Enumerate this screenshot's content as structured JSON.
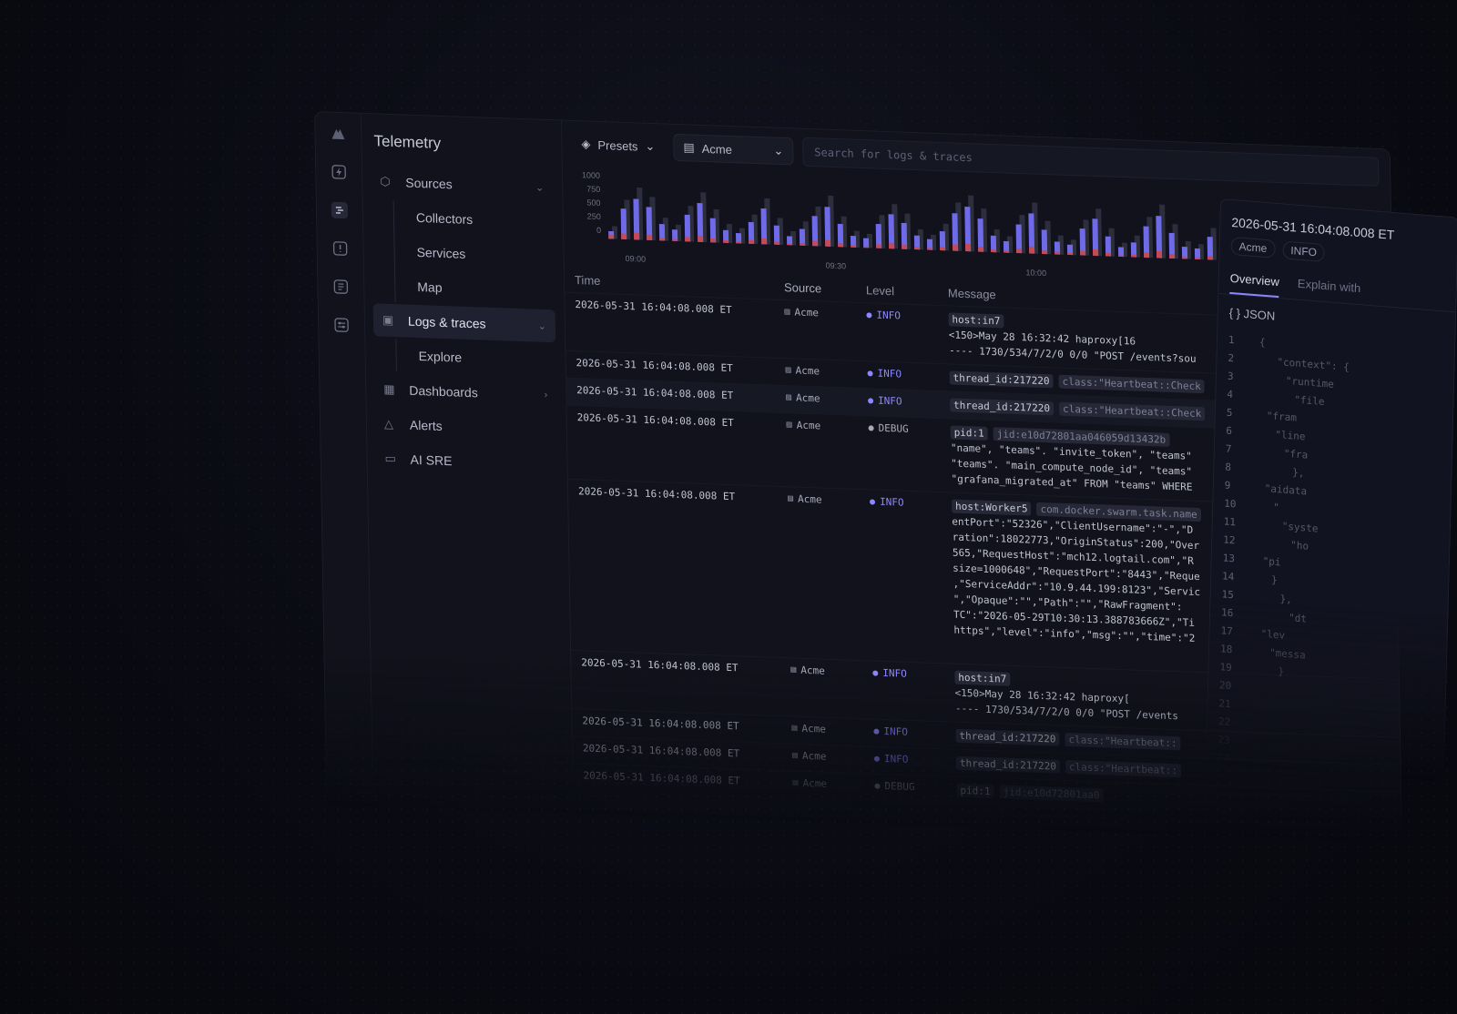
{
  "app": {
    "title": "Telemetry"
  },
  "sidebar": {
    "sources": "Sources",
    "sources_sub": [
      "Collectors",
      "Services",
      "Map"
    ],
    "logs": "Logs & traces",
    "logs_sub": [
      "Explore"
    ],
    "dashboards": "Dashboards",
    "alerts": "Alerts",
    "ai": "AI SRE"
  },
  "topbar": {
    "presets": "Presets",
    "source": "Acme",
    "search_placeholder": "Search for logs & traces"
  },
  "chart_data": {
    "type": "bar",
    "y_ticks": [
      "1000",
      "750",
      "500",
      "250",
      "0"
    ],
    "x_ticks": [
      "09:00",
      "09:30",
      "10:00"
    ],
    "ylim": [
      0,
      1000
    ],
    "series": [
      {
        "values": [
          120,
          480,
          640,
          520,
          260,
          180,
          420,
          610,
          380,
          200,
          160,
          340,
          560,
          300,
          140,
          260,
          470,
          620,
          360,
          180,
          150,
          380,
          540,
          410,
          220,
          170,
          300,
          590,
          700,
          520,
          260,
          180,
          450,
          630,
          380,
          200,
          160,
          420,
          580,
          310,
          150,
          230,
          490,
          660,
          400,
          190,
          170,
          360,
          560,
          330,
          160,
          280,
          520,
          610,
          390,
          200,
          160,
          420,
          500,
          250
        ]
      },
      {
        "values": [
          60,
          90,
          110,
          80,
          40,
          30,
          70,
          100,
          60,
          40,
          30,
          60,
          90,
          50,
          20,
          40,
          80,
          100,
          60,
          30,
          20,
          60,
          90,
          70,
          40,
          30,
          50,
          100,
          120,
          80,
          40,
          30,
          70,
          110,
          60,
          40,
          30,
          70,
          100,
          50,
          20,
          40,
          80,
          110,
          70,
          30,
          30,
          60,
          90,
          50,
          30,
          50,
          90,
          100,
          60,
          40,
          30,
          70,
          80,
          40
        ]
      },
      {
        "values": [
          200,
          620,
          820,
          680,
          360,
          260,
          560,
          780,
          520,
          300,
          240,
          460,
          720,
          420,
          220,
          380,
          620,
          800,
          480,
          260,
          220,
          520,
          700,
          560,
          320,
          240,
          420,
          760,
          880,
          680,
          360,
          260,
          600,
          800,
          520,
          300,
          240,
          560,
          740,
          440,
          220,
          340,
          640,
          840,
          540,
          280,
          240,
          500,
          720,
          460,
          240,
          400,
          680,
          780,
          520,
          300,
          240,
          560,
          660,
          360
        ]
      }
    ],
    "colors": {
      "info": "#6f6ae8",
      "error": "#c24b55",
      "total": "#2c2e3d"
    }
  },
  "table": {
    "headers": [
      "Time",
      "Source",
      "Level",
      "Message"
    ],
    "rows": [
      {
        "time": "2026-05-31 16:04:08.008 ET",
        "source": "Acme",
        "level": "INFO",
        "tags": [
          "host:in7"
        ],
        "lines": [
          "<150>May 28 16:32:42 haproxy[16",
          "---- 1730/534/7/2/0 0/0 \"POST /events?sou"
        ]
      },
      {
        "time": "2026-05-31 16:04:08.008 ET",
        "source": "Acme",
        "level": "INFO",
        "tags": [
          "thread_id:217220",
          "class:\"Heartbeat::Check"
        ],
        "lines": []
      },
      {
        "time": "2026-05-31 16:04:08.008 ET",
        "source": "Acme",
        "level": "INFO",
        "tags": [
          "thread_id:217220",
          "class:\"Heartbeat::Check"
        ],
        "lines": []
      },
      {
        "time": "2026-05-31 16:04:08.008 ET",
        "source": "Acme",
        "level": "DEBUG",
        "tags": [
          "pid:1",
          "jid:e10d72801aa046059d13432b"
        ],
        "lines": [
          "\"name\", \"teams\". \"invite_token\", \"teams\"",
          "\"teams\". \"main_compute_node_id\", \"teams\"",
          "\"grafana_migrated_at\" FROM \"teams\" WHERE"
        ]
      },
      {
        "time": "2026-05-31 16:04:08.008 ET",
        "source": "Acme",
        "level": "INFO",
        "tags": [
          "host:Worker5",
          "com.docker.swarm.task.name"
        ],
        "lines": [
          "entPort\":\"52326\",\"ClientUsername\":\"-\",\"D",
          "ration\":18022773,\"OriginStatus\":200,\"Over",
          "565,\"RequestHost\":\"mch12.logtail.com\",\"R",
          "size=1000648\",\"RequestPort\":\"8443\",\"Reque",
          ",\"ServiceAddr\":\"10.9.44.199:8123\",\"Servic",
          "\",\"Opaque\":\"\",\"Path\":\"\",\"RawFragment\":",
          "TC\":\"2026-05-29T10:30:13.388783666Z\",\"Ti",
          "https\",\"level\":\"info\",\"msg\":\"\",\"time\":\"2"
        ]
      },
      {
        "time": "2026-05-31 16:04:08.008 ET",
        "source": "Acme",
        "level": "INFO",
        "tags": [
          "host:in7"
        ],
        "lines": [
          "<150>May 28 16:32:42 haproxy[",
          "---- 1730/534/7/2/0 0/0 \"POST /events"
        ]
      },
      {
        "time": "2026-05-31 16:04:08.008 ET",
        "source": "Acme",
        "level": "INFO",
        "tags": [
          "thread_id:217220",
          "class:\"Heartbeat::"
        ],
        "lines": []
      },
      {
        "time": "2026-05-31 16:04:08.008 ET",
        "source": "Acme",
        "level": "INFO",
        "tags": [
          "thread_id:217220",
          "class:\"Heartbeat::"
        ],
        "lines": []
      },
      {
        "time": "2026-05-31 16:04:08.008 ET",
        "source": "Acme",
        "level": "DEBUG",
        "tags": [
          "pid:1",
          "jid:e10d72801aa0"
        ],
        "lines": []
      }
    ]
  },
  "detail": {
    "title": "2026-05-31 16:04:08.008 ET",
    "source": "Acme",
    "level": "INFO",
    "tabs": [
      "Overview",
      "Explain with"
    ],
    "json_label": "{ } JSON",
    "lines": [
      "{",
      "\"context\": {",
      "\"runtime",
      "\"file",
      "\"fram",
      "\"line",
      "\"fra",
      "},",
      "\"aidata",
      "\"",
      "\"syste",
      "\"ho",
      "\"pi",
      "}",
      "},",
      "\"dt",
      "\"lev",
      "\"messa",
      "}",
      "",
      "",
      "",
      "",
      ""
    ]
  }
}
